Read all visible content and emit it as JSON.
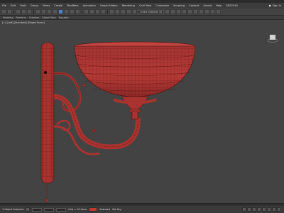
{
  "menubar": {
    "items": [
      "File",
      "Edit",
      "Tools",
      "Group",
      "Views",
      "Create",
      "Modifiers",
      "Animation",
      "Graph Editors",
      "Rendering",
      "Civil View",
      "Customize",
      "Scripting",
      "Content",
      "Arnold",
      "Help",
      "3DS2016"
    ],
    "signin_label": "Sign In"
  },
  "toolbar": {
    "selection_set": "Create Selection Se"
  },
  "ribbon": {
    "tabs": [
      "Modeling",
      "Freeform",
      "Selection",
      "Object Paint",
      "Populate"
    ]
  },
  "viewport": {
    "label": "[+] [Left] [Standard] [Edged Faces]",
    "mesh_color": "#b53a36",
    "wire_color": "#5a1210",
    "background": "#434343"
  },
  "status": {
    "selection": "1 Object Selected",
    "grid": "Grid = 10.0mm",
    "autokey": "Auto Key",
    "setkey": "Set Key",
    "selected_option": "Selected"
  },
  "colors": {
    "accent": "#4a82c6",
    "key": "#c0392b"
  }
}
